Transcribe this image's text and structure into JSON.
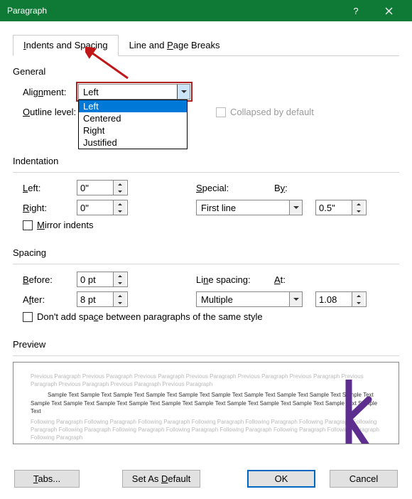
{
  "window": {
    "title": "Paragraph"
  },
  "tabs": {
    "indents": "Indents and Spacing",
    "linebreaks": "Line and Page Breaks"
  },
  "general": {
    "section": "General",
    "alignment_label": "Alignment:",
    "alignment_value": "Left",
    "alignment_options": {
      "left": "Left",
      "centered": "Centered",
      "right": "Right",
      "justified": "Justified"
    },
    "outline_label": "Outline level:",
    "collapsed_label": "Collapsed by default"
  },
  "indentation": {
    "section": "Indentation",
    "left_label": "Left:",
    "left_value": "0\"",
    "right_label": "Right:",
    "right_value": "0\"",
    "special_label": "Special:",
    "special_value": "First line",
    "by_label": "By:",
    "by_value": "0.5\"",
    "mirror_label": "Mirror indents"
  },
  "spacing": {
    "section": "Spacing",
    "before_label": "Before:",
    "before_value": "0 pt",
    "after_label": "After:",
    "after_value": "8 pt",
    "line_spacing_label": "Line spacing:",
    "line_spacing_value": "Multiple",
    "at_label": "At:",
    "at_value": "1.08",
    "noadd_label": "Don't add space between paragraphs of the same style"
  },
  "preview": {
    "section": "Preview",
    "prev_text": "Previous Paragraph Previous Paragraph Previous Paragraph Previous Paragraph Previous Paragraph Previous Paragraph Previous Paragraph Previous Paragraph Previous Paragraph Previous Paragraph",
    "sample_text": "Sample Text Sample Text Sample Text Sample Text Sample Text Sample Text Sample Text Sample Text Sample Text Sample Text Sample Text Sample Text Sample Text Sample Text Sample Text Sample Text Sample Text Sample Text Sample Text Sample Text Sample Text",
    "follow_text": "Following Paragraph Following Paragraph Following Paragraph Following Paragraph Following Paragraph Following Paragraph Following Paragraph Following Paragraph Following Paragraph Following Paragraph Following Paragraph Following Paragraph Following Paragraph Following Paragraph"
  },
  "buttons": {
    "tabs": "Tabs...",
    "setdefault": "Set As Default",
    "ok": "OK",
    "cancel": "Cancel"
  }
}
